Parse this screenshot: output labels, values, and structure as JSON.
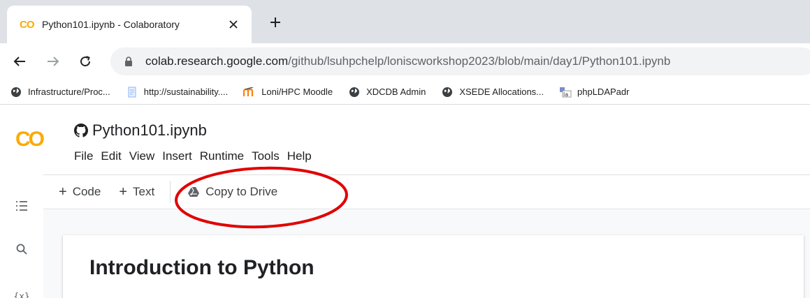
{
  "browser": {
    "tab": {
      "favicon": "CO",
      "title": "Python101.ipynb - Colaboratory",
      "close_glyph": "✕"
    },
    "new_tab_glyph": "+",
    "nav": {
      "back": "←",
      "forward": "→",
      "reload": "C"
    },
    "url": {
      "host": "colab.research.google.com",
      "path": "/github/lsuhpchelp/loniscworkshop2023/blob/main/day1/Python101.ipynb"
    }
  },
  "bookmarks": [
    {
      "label": "Infrastructure/Proc...",
      "icon": "globe-icon"
    },
    {
      "label": "http://sustainability....",
      "icon": "page-icon"
    },
    {
      "label": "Loni/HPC Moodle",
      "icon": "moodle-icon"
    },
    {
      "label": "XDCDB Admin",
      "icon": "globe-icon"
    },
    {
      "label": "XSEDE Allocations...",
      "icon": "globe-icon"
    },
    {
      "label": "phpLDAPadr",
      "icon": "phpldap-icon"
    }
  ],
  "colab": {
    "logo": {
      "c": "C",
      "o": "O"
    },
    "notebook_title": "Python101.ipynb",
    "menu": [
      "File",
      "Edit",
      "View",
      "Insert",
      "Runtime",
      "Tools",
      "Help"
    ],
    "toolbar": {
      "plus": "+",
      "code_label": "Code",
      "text_label": "Text",
      "copy_to_drive_label": "Copy to Drive"
    },
    "rail": {
      "variables_label": "{x}"
    },
    "cell_heading": "Introduction to Python"
  },
  "colors": {
    "colab_yellow": "#f9ab00",
    "colab_orange": "#e8710a",
    "annotation_red": "#e00000"
  }
}
